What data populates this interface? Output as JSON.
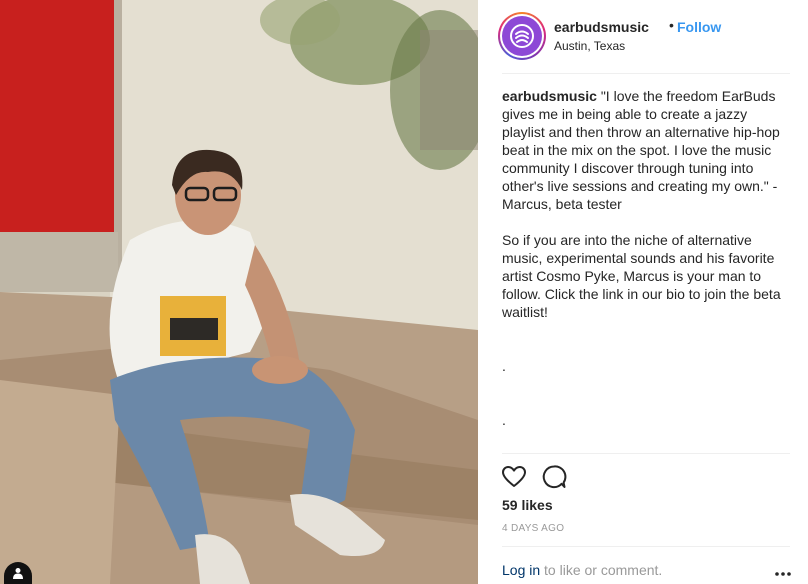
{
  "post": {
    "username": "earbudsmusic",
    "separator": "•",
    "follow_label": "Follow",
    "location": "Austin, Texas",
    "caption": {
      "username": "earbudsmusic",
      "quote": "\"I love the freedom EarBuds gives me in being able to create a jazzy playlist and then throw an alternative hip-hop beat in the mix on the spot. I love the music community I discover through tuning into other's live sessions and creating my own.\" - Marcus, beta tester",
      "paragraph_2": "So if you are into the niche of alternative music, experimental sounds and his favorite artist Cosmo Pyke, Marcus is your man to follow. Click the link in our bio to join the beta waitlist!",
      "bullet_1": ".",
      "bullet_2": "."
    },
    "likes": "59 likes",
    "timestamp": "4 DAYS AGO",
    "login_label": "Log in",
    "comment_suffix": " to like or comment."
  },
  "icons": {
    "avatar": "earbuds-logo-icon",
    "like": "heart-icon",
    "comment": "comment-bubble-icon",
    "more": "more-options-icon",
    "tag": "user-tag-icon"
  },
  "colors": {
    "follow": "#3897f0",
    "login": "#003569",
    "avatar_bg": "#8d48d6",
    "door": "#c8201e"
  }
}
